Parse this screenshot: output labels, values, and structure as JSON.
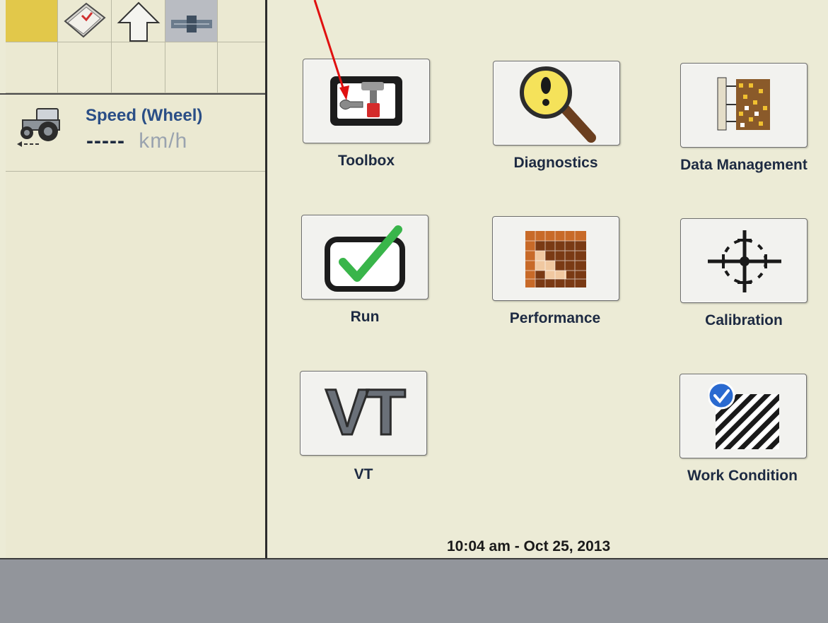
{
  "speed": {
    "title": "Speed (Wheel)",
    "value": "-----",
    "unit": "km/h"
  },
  "apps": [
    {
      "label": "Toolbox",
      "icon": "toolbox-icon"
    },
    {
      "label": "Diagnostics",
      "icon": "magnifier-warning-icon"
    },
    {
      "label": "Data Management",
      "icon": "data-grid-icon"
    },
    {
      "label": "Run",
      "icon": "checkmark-icon"
    },
    {
      "label": "Performance",
      "icon": "heatmap-icon"
    },
    {
      "label": "Calibration",
      "icon": "crosshair-icon"
    },
    {
      "label": "VT",
      "icon": "vt-letters-icon"
    },
    {
      "label": "Work Condition",
      "icon": "hatched-check-icon"
    }
  ],
  "vt_letters": "VT",
  "status": {
    "datetime": "10:04 am - Oct 25, 2013"
  },
  "colors": {
    "background": "#ecebd6",
    "accent_blue": "#2a4e86",
    "annotation_arrow": "#e01010",
    "check_green": "#39b54a"
  }
}
